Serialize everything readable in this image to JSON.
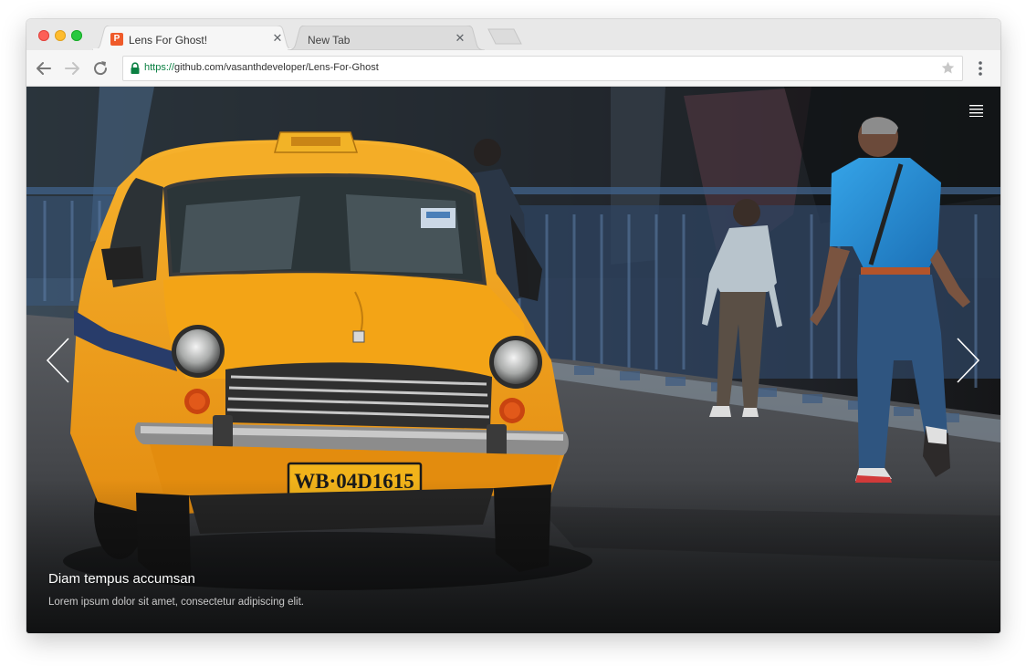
{
  "browser": {
    "tabs": [
      {
        "title": "Lens For Ghost!",
        "favicon_letter": "P",
        "active": true
      },
      {
        "title": "New Tab",
        "active": false
      }
    ],
    "url": {
      "scheme": "https://",
      "rest": "github.com/vasanthdeveloper/Lens-For-Ghost"
    }
  },
  "page": {
    "slide": {
      "title": "Diam tempus accumsan",
      "text": "Lorem ipsum dolor sit amet, consectetur adipiscing elit.",
      "plate": "WB·04D1615"
    }
  },
  "icons": {
    "nav_back": "arrow-left-icon",
    "nav_forward": "arrow-right-icon",
    "nav_reload": "reload-icon",
    "secure": "lock-icon",
    "bookmark": "star-icon",
    "browser_menu": "vertical-dots-icon",
    "site_menu": "hamburger-icon",
    "slide_prev": "chevron-left-icon",
    "slide_next": "chevron-right-icon"
  },
  "colors": {
    "url_scheme": "#0b8043",
    "favicon": "#ef5a2a",
    "taxi": "#f4a31b"
  }
}
